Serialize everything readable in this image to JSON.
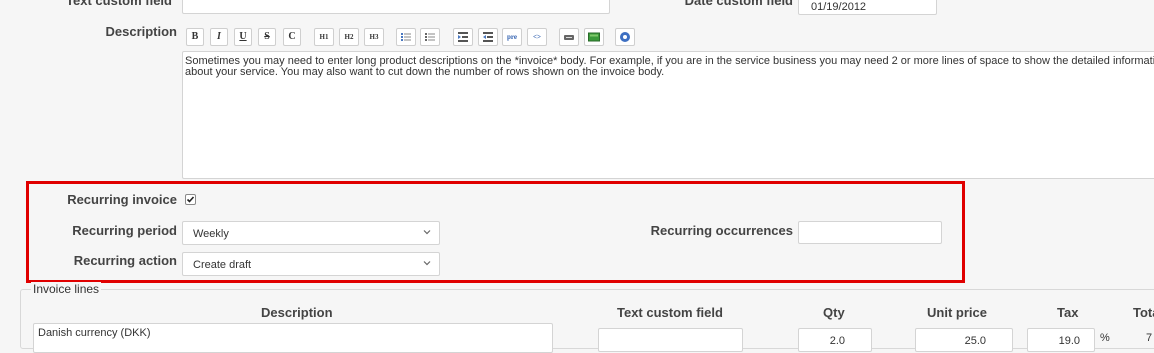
{
  "form": {
    "text_custom_field_label": "Text custom field",
    "date_custom_field_label": "Date custom field",
    "date_custom_field_value": "01/19/2012",
    "description_label": "Description",
    "description_text": "Sometimes you may need to enter long product descriptions on the *invoice* body. For example, if you are in the service business you may need 2 or more lines of space to show the detailed informati about your service. You may also want to cut down the number of rows shown on the invoice body."
  },
  "toolbar": {
    "bold": "B",
    "italic": "I",
    "underline": "U",
    "strike": "S",
    "clear": "C",
    "h1": "H1",
    "h2": "H2",
    "h3": "H3",
    "pre": "pre",
    "code": "<>"
  },
  "recurring": {
    "invoice_label": "Recurring invoice",
    "invoice_checked": true,
    "period_label": "Recurring period",
    "period_value": "Weekly",
    "action_label": "Recurring action",
    "action_value": "Create draft",
    "occurrences_label": "Recurring occurrences",
    "occurrences_value": ""
  },
  "invoice_lines": {
    "legend": "Invoice lines",
    "headers": {
      "description": "Description",
      "text_custom_field": "Text custom field",
      "qty": "Qty",
      "unit_price": "Unit price",
      "tax": "Tax",
      "total": "Tota"
    },
    "row1": {
      "description": "Danish currency (DKK)",
      "qty": "2.0",
      "unit_price": "25.0",
      "tax": "19.0",
      "tax_unit": "%",
      "total": "7"
    }
  },
  "colors": {
    "highlight": "#e00000",
    "page_bg": "#f6f6f6"
  }
}
